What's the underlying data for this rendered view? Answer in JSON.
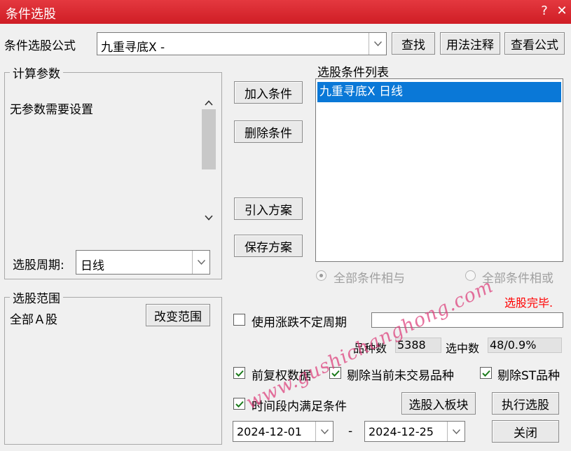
{
  "window": {
    "title": "条件选股",
    "help_glyph": "?",
    "close_glyph": "✕"
  },
  "formula": {
    "label": "条件选股公式",
    "value": "九重寻底X  -",
    "find_button": "查找",
    "usage_button": "用法注释",
    "view_button": "查看公式"
  },
  "params": {
    "group_title": "计算参数",
    "message": "无参数需要设置",
    "period_label": "选股周期:",
    "period_value": "日线"
  },
  "condition_buttons": {
    "add": "加入条件",
    "delete": "删除条件",
    "import": "引入方案",
    "save": "保存方案"
  },
  "condition_list": {
    "title": "选股条件列表",
    "items": [
      "九重寻底X  日线"
    ],
    "radio_and": "全部条件相与",
    "radio_or": "全部条件相或"
  },
  "range": {
    "group_title": "选股范围",
    "value": "全部Ａ股",
    "change_button": "改变范围"
  },
  "status": {
    "done_text": "选股完毕."
  },
  "uncertain_period": {
    "label": "使用涨跌不定周期",
    "checked": false,
    "value": ""
  },
  "stats": {
    "count_label": "品种数",
    "count_value": "5388",
    "selected_label": "选中数",
    "selected_value": "48/0.9%"
  },
  "options": {
    "adjusted_label": "前复权数据",
    "adjusted_checked": true,
    "exclude_notrade_label": "剔除当前未交易品种",
    "exclude_notrade_checked": true,
    "exclude_st_label": "剔除ST品种",
    "exclude_st_checked": true,
    "time_range_label": "时间段内满足条件",
    "time_range_checked": true
  },
  "dates": {
    "start": "2024-12-01",
    "separator": "-",
    "end": "2024-12-25"
  },
  "actions": {
    "to_block": "选股入板块",
    "execute": "执行选股",
    "close": "关闭"
  },
  "watermark": "www.gushichanghong.com",
  "colors": {
    "titlebar": "#d9262e",
    "selection": "#0a78d7",
    "status_red": "#ff0000"
  }
}
